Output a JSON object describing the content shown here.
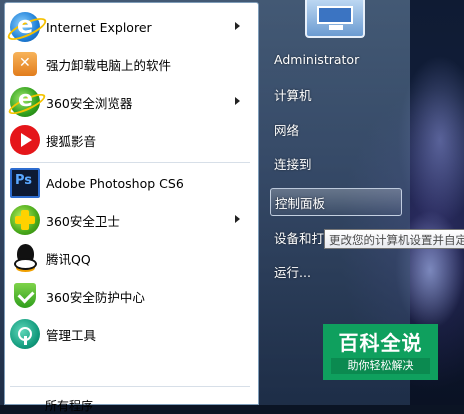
{
  "programs": [
    {
      "label": "Internet Explorer",
      "icon": "internet-explorer-icon",
      "submenu": true
    },
    {
      "label": "强力卸载电脑上的软件",
      "icon": "uninstall-icon",
      "submenu": false
    },
    {
      "label": "360安全浏览器",
      "icon": "browser-360-icon",
      "submenu": true
    },
    {
      "label": "搜狐影音",
      "icon": "sohu-video-icon",
      "submenu": false
    },
    {
      "label": "Adobe Photoshop CS6",
      "icon": "photoshop-icon",
      "submenu": false
    },
    {
      "label": "360安全卫士",
      "icon": "360-guard-icon",
      "submenu": true
    },
    {
      "label": "腾讯QQ",
      "icon": "qq-icon",
      "submenu": false
    },
    {
      "label": "360安全防护中心",
      "icon": "360-protection-icon",
      "submenu": false
    },
    {
      "label": "管理工具",
      "icon": "admin-tools-icon",
      "submenu": false
    }
  ],
  "all_programs_partial": "所有程序",
  "right_pane": [
    {
      "label": "Administrator"
    },
    {
      "label": "计算机"
    },
    {
      "label": "网络"
    },
    {
      "label": "连接到"
    },
    {
      "label": "控制面板",
      "highlighted": true
    },
    {
      "label": "设备和打"
    },
    {
      "label": "运行..."
    }
  ],
  "tooltip": "更改您的计算机设置并自定义",
  "watermark": {
    "title": "百科全说",
    "subtitle": "助你轻松解决"
  },
  "colors": {
    "highlight_border": "#e6f0ff",
    "watermark_bg": "#0fa05e"
  }
}
